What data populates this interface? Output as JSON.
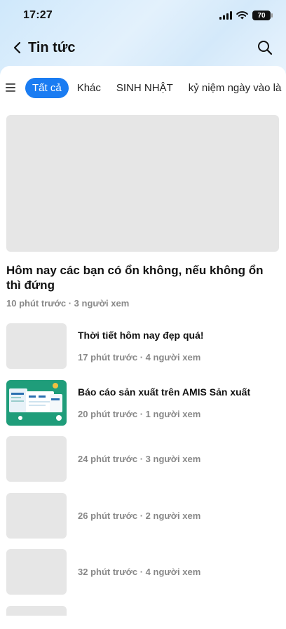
{
  "status_bar": {
    "time": "17:27",
    "battery": "70"
  },
  "nav": {
    "title": "Tin tức"
  },
  "tabs": [
    {
      "label": "Tất cả",
      "active": true
    },
    {
      "label": "Khác"
    },
    {
      "label": "SINH NHẬT"
    },
    {
      "label": "kỷ niệm ngày vào là"
    }
  ],
  "featured": {
    "title": "Hôm nay các bạn có ổn không, nếu không ổn thì đứng",
    "meta": "10 phút trước · 3 người xem"
  },
  "articles": [
    {
      "title": "Thời tiết hôm nay đẹp quá!",
      "meta": "17 phút trước · 4 người xem"
    },
    {
      "title": "Báo cáo sản xuất trên AMIS Sản xuất",
      "meta": "20 phút trước · 1 người xem"
    },
    {
      "title": "",
      "meta": "24 phút trước · 3 người xem"
    },
    {
      "title": "",
      "meta": "26 phút trước · 2 người xem"
    },
    {
      "title": "",
      "meta": "32 phút trước · 4 người xem"
    }
  ],
  "colors": {
    "accent": "#1a7cf2",
    "placeholder": "#e6e6e6",
    "meta": "#888888",
    "thumb_green": "#1f9d7a"
  },
  "icons": [
    "back-chevron-icon",
    "search-icon",
    "menu-icon",
    "signal-icon",
    "wifi-icon",
    "battery-icon"
  ]
}
